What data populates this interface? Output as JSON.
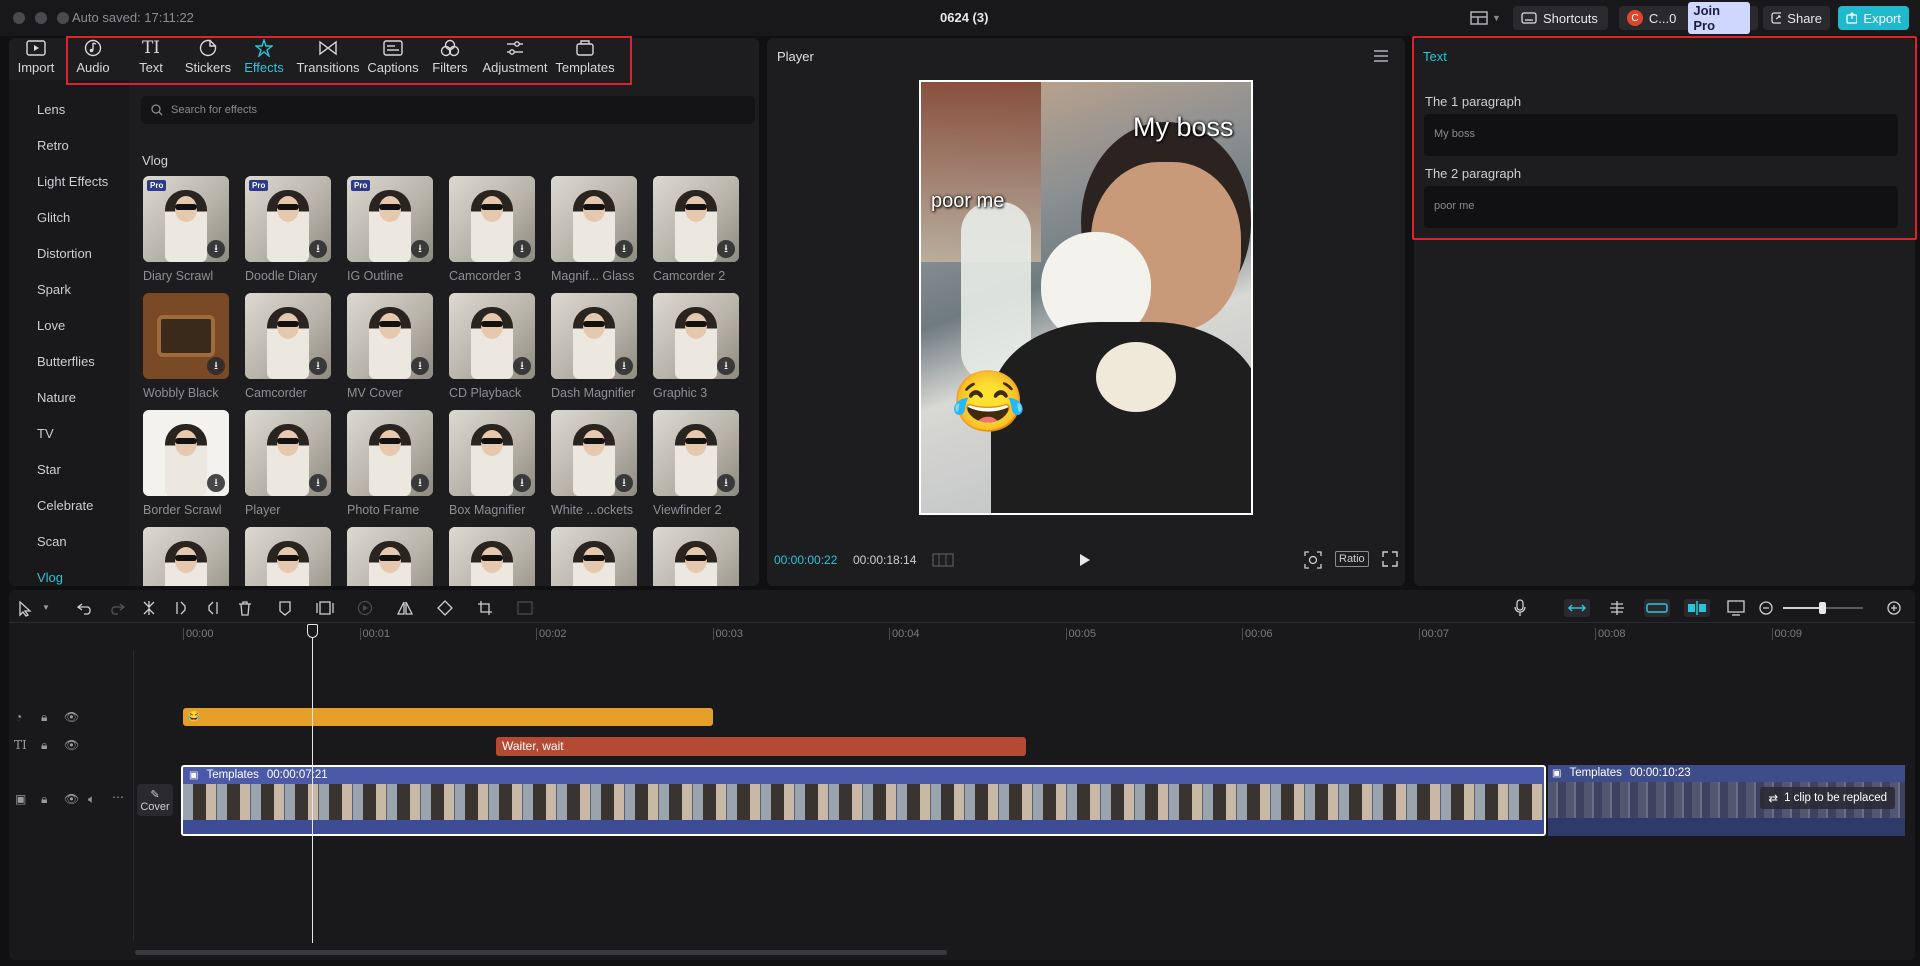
{
  "titlebar": {
    "autosave": "Auto saved: 17:11:22",
    "project": "0624 (3)",
    "shortcuts": "Shortcuts",
    "account": "C...0",
    "join_pro": "Join Pro",
    "share": "Share",
    "export": "Export"
  },
  "toolbar": {
    "tabs": [
      {
        "label": "Import",
        "icon": "import-icon"
      },
      {
        "label": "Audio",
        "icon": "audio-icon"
      },
      {
        "label": "Text",
        "icon": "text-icon"
      },
      {
        "label": "Stickers",
        "icon": "stickers-icon"
      },
      {
        "label": "Effects",
        "icon": "effects-icon",
        "active": true
      },
      {
        "label": "Transitions",
        "icon": "transitions-icon"
      },
      {
        "label": "Captions",
        "icon": "captions-icon"
      },
      {
        "label": "Filters",
        "icon": "filters-icon"
      },
      {
        "label": "Adjustment",
        "icon": "adjustment-icon"
      },
      {
        "label": "Templates",
        "icon": "templates-icon"
      }
    ]
  },
  "effects": {
    "categories": [
      "Lens",
      "Retro",
      "Light Effects",
      "Glitch",
      "Distortion",
      "Spark",
      "Love",
      "Butterflies",
      "Nature",
      "TV",
      "Star",
      "Celebrate",
      "Scan",
      "Vlog"
    ],
    "active_category": "Vlog",
    "search_placeholder": "Search for effects",
    "section_title": "Vlog",
    "items": [
      "Diary Scrawl",
      "Doodle Diary",
      "IG Outline",
      "Camcorder 3",
      "Magnif... Glass",
      "Camcorder 2",
      "Wobbly Black",
      "Camcorder",
      "MV Cover",
      "CD Playback",
      "Dash Magnifier",
      "Graphic 3",
      "Border Scrawl",
      "Player",
      "Photo Frame",
      "Box Magnifier",
      "White ...ockets",
      "Viewfinder 2"
    ]
  },
  "player": {
    "title": "Player",
    "caption_top": "My boss",
    "caption_left": "poor me",
    "current_time": "00:00:00:22",
    "total_time": "00:00:18:14",
    "ratio": "Ratio"
  },
  "text_panel": {
    "title": "Text",
    "paragraphs": [
      {
        "label": "The 1 paragraph",
        "value": "My boss"
      },
      {
        "label": "The 2 paragraph",
        "value": "poor me"
      }
    ]
  },
  "timeline": {
    "ruler": [
      "00:00",
      "00:01",
      "00:02",
      "00:03",
      "00:04",
      "00:05",
      "00:06",
      "00:07",
      "00:08",
      "00:09"
    ],
    "text_clip": "Waiter, wait",
    "sticker_clip": "😂",
    "main_clip": {
      "label": "Templates",
      "duration": "00:00:07:21"
    },
    "second_clip": {
      "label": "Templates",
      "duration": "00:00:10:23",
      "note": "1 clip to be replaced"
    },
    "cover": "Cover"
  },
  "colors": {
    "accent": "#2cc4d8",
    "highlight_box": "#e0202a",
    "sticker_track": "#e6a028",
    "text_track": "#b54a34",
    "main_track": "#4b5aa8"
  }
}
